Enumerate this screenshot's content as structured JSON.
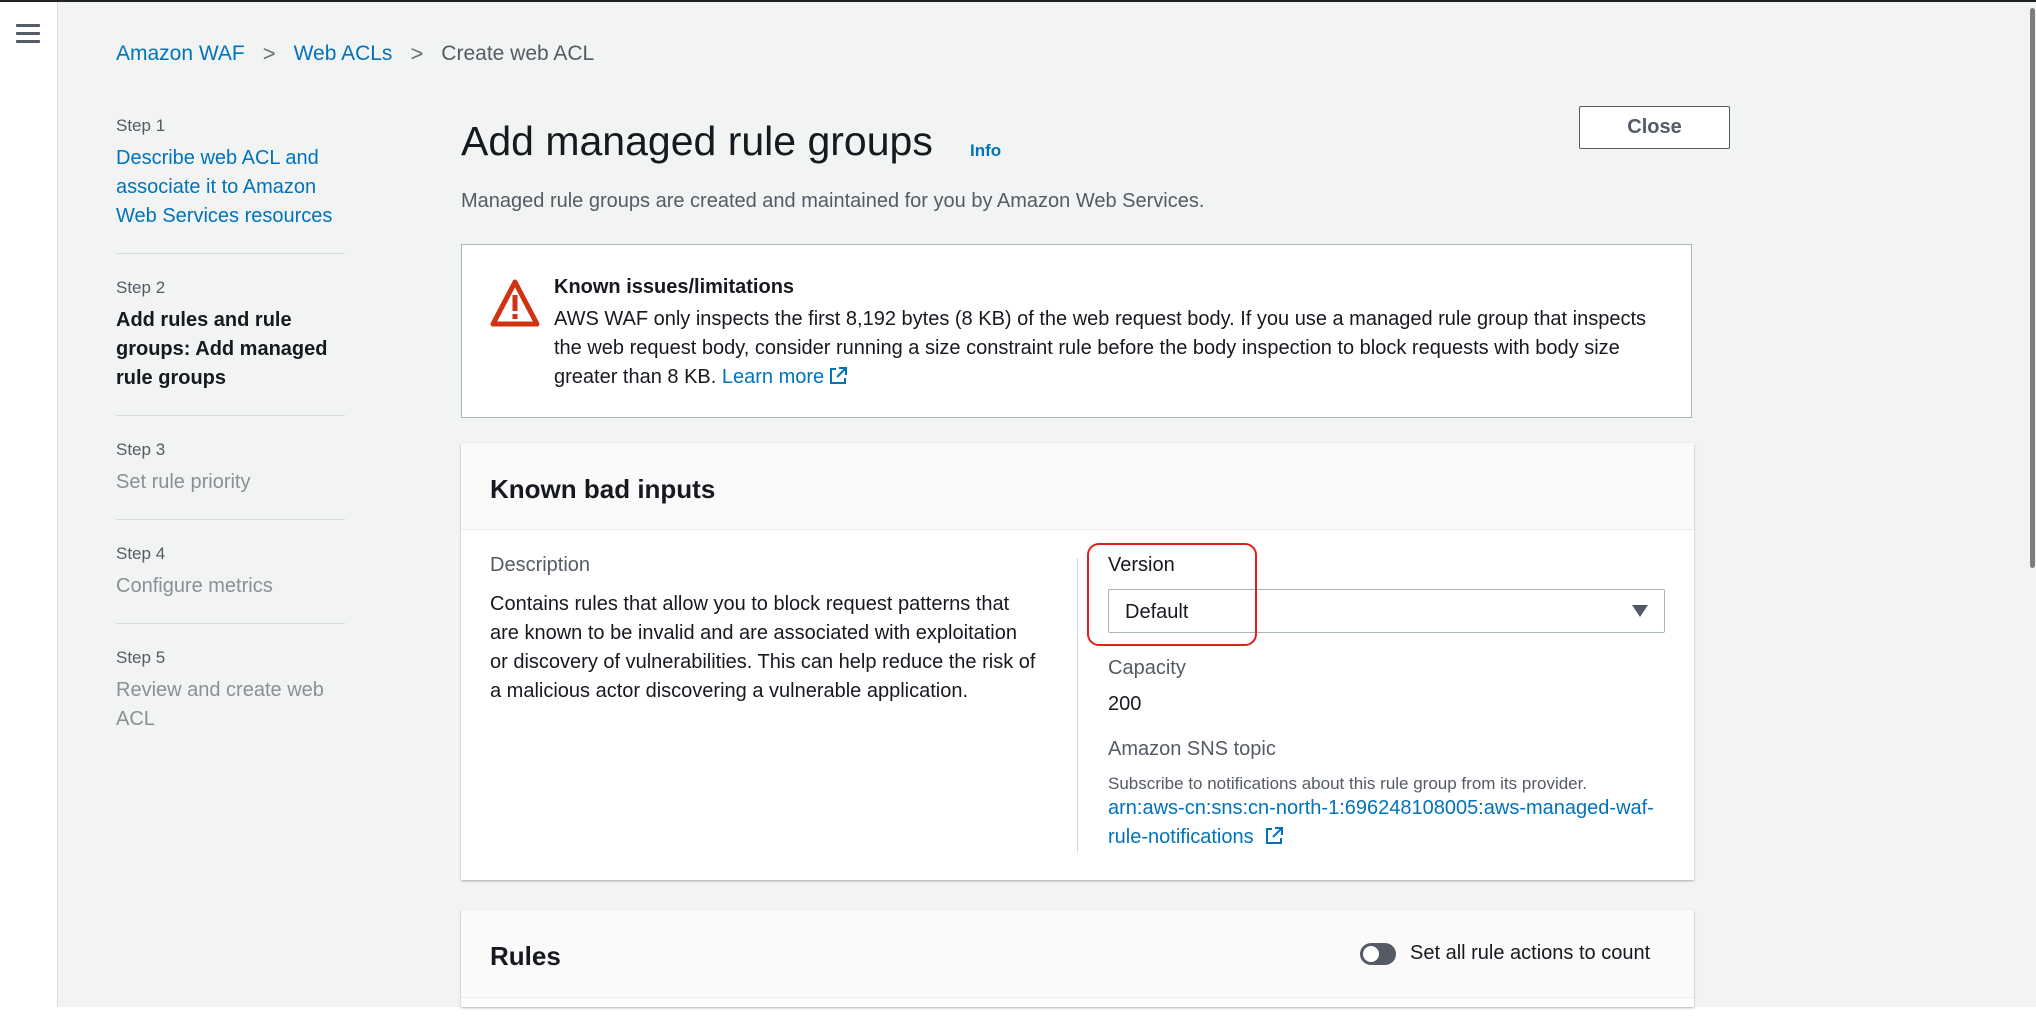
{
  "breadcrumb": {
    "items": [
      "Amazon WAF",
      "Web ACLs",
      "Create web ACL"
    ],
    "separator": ">"
  },
  "steps": [
    {
      "number": "Step 1",
      "title": "Describe web ACL and associate it to Amazon Web Services resources"
    },
    {
      "number": "Step 2",
      "title": "Add rules and rule groups: Add managed rule groups"
    },
    {
      "number": "Step 3",
      "title": "Set rule priority"
    },
    {
      "number": "Step 4",
      "title": "Configure metrics"
    },
    {
      "number": "Step 5",
      "title": "Review and create web ACL"
    }
  ],
  "header": {
    "title": "Add managed rule groups",
    "info": "Info",
    "subtitle": "Managed rule groups are created and maintained for you by Amazon Web Services.",
    "close_label": "Close"
  },
  "alert": {
    "title": "Known issues/limitations",
    "body": "AWS WAF only inspects the first 8,192 bytes (8 KB) of the web request body. If you use a managed rule group that inspects the web request body, consider running a size constraint rule before the body inspection to block requests with body size greater than 8 KB.",
    "link": "Learn more",
    "icon": "warning-triangle-icon"
  },
  "rule_group": {
    "title": "Known bad inputs",
    "description_label": "Description",
    "description": "Contains rules that allow you to block request patterns that are known to be invalid and are associated with exploitation or discovery of vulnerabilities. This can help reduce the risk of a malicious actor discovering a vulnerable application.",
    "version_label": "Version",
    "version_value": "Default",
    "capacity_label": "Capacity",
    "capacity_value": "200",
    "sns_label": "Amazon SNS topic",
    "sns_desc": "Subscribe to notifications about this rule group from its provider.",
    "sns_link": "arn:aws-cn:sns:cn-north-1:696248108005:aws-managed-waf-rule-notifications"
  },
  "rules": {
    "title": "Rules",
    "toggle_label": "Set all rule actions to count"
  },
  "colors": {
    "link": "#0073bb",
    "warning": "#d13212",
    "highlight": "#e0201c",
    "background": "#f2f3f3"
  }
}
